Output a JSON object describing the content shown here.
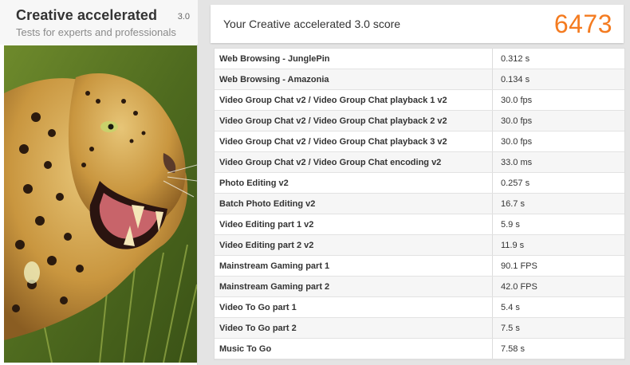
{
  "panel": {
    "title": "Creative accelerated",
    "version": "3.0",
    "subtitle": "Tests for experts and professionals",
    "image_name": "leopard-artwork"
  },
  "score": {
    "label": "Your Creative accelerated 3.0 score",
    "value": "6473",
    "color": "#f47b20"
  },
  "results": [
    {
      "name": "Web Browsing - JunglePin",
      "value": "0.312 s"
    },
    {
      "name": "Web Browsing - Amazonia",
      "value": "0.134 s"
    },
    {
      "name": "Video Group Chat v2 / Video Group Chat playback 1 v2",
      "value": "30.0 fps"
    },
    {
      "name": "Video Group Chat v2 / Video Group Chat playback 2 v2",
      "value": "30.0 fps"
    },
    {
      "name": "Video Group Chat v2 / Video Group Chat playback 3 v2",
      "value": "30.0 fps"
    },
    {
      "name": "Video Group Chat v2 / Video Group Chat encoding v2",
      "value": "33.0 ms"
    },
    {
      "name": "Photo Editing v2",
      "value": "0.257 s"
    },
    {
      "name": "Batch Photo Editing v2",
      "value": "16.7 s"
    },
    {
      "name": "Video Editing part 1 v2",
      "value": "5.9 s"
    },
    {
      "name": "Video Editing part 2 v2",
      "value": "11.9 s"
    },
    {
      "name": "Mainstream Gaming part 1",
      "value": "90.1 FPS"
    },
    {
      "name": "Mainstream Gaming part 2",
      "value": "42.0 FPS"
    },
    {
      "name": "Video To Go part 1",
      "value": "5.4 s"
    },
    {
      "name": "Video To Go part 2",
      "value": "7.5 s"
    },
    {
      "name": "Music To Go",
      "value": "7.58 s"
    }
  ]
}
